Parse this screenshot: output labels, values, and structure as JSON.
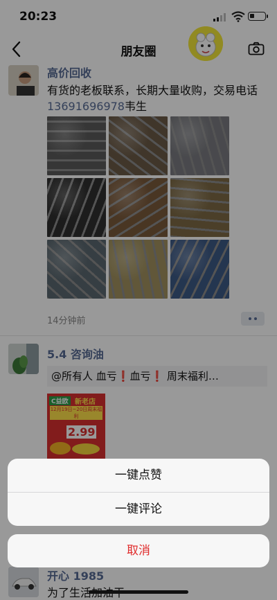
{
  "status_bar": {
    "time": "20:23"
  },
  "nav": {
    "title": "朋友圈"
  },
  "posts": [
    {
      "name": "高价回收",
      "text_before": "有货的老板联系，长期大量收购，交易电话",
      "phone": "13691696978",
      "text_after": "韦生",
      "time": "14分钟前",
      "image_colors": [
        "#5a5a5a",
        "#6b5a46",
        "#7a7b80",
        "#2f2f2f",
        "#7b5a3b",
        "#7d6a45",
        "#5b6870",
        "#a2925f",
        "#3d5a86"
      ]
    },
    {
      "name": "5.4 咨询油",
      "share_text": "@所有人 血亏❗血亏❗  周末福利…",
      "poster": {
        "tag": "C益欧",
        "store": "新老店",
        "date": "12月19日~20日周末福利",
        "price": "2.99"
      }
    },
    {
      "name": "开心 1985",
      "text": "为了生活加油干"
    }
  ],
  "action_sheet": {
    "items": [
      "一键点赞",
      "一键评论"
    ],
    "cancel": "取消"
  }
}
